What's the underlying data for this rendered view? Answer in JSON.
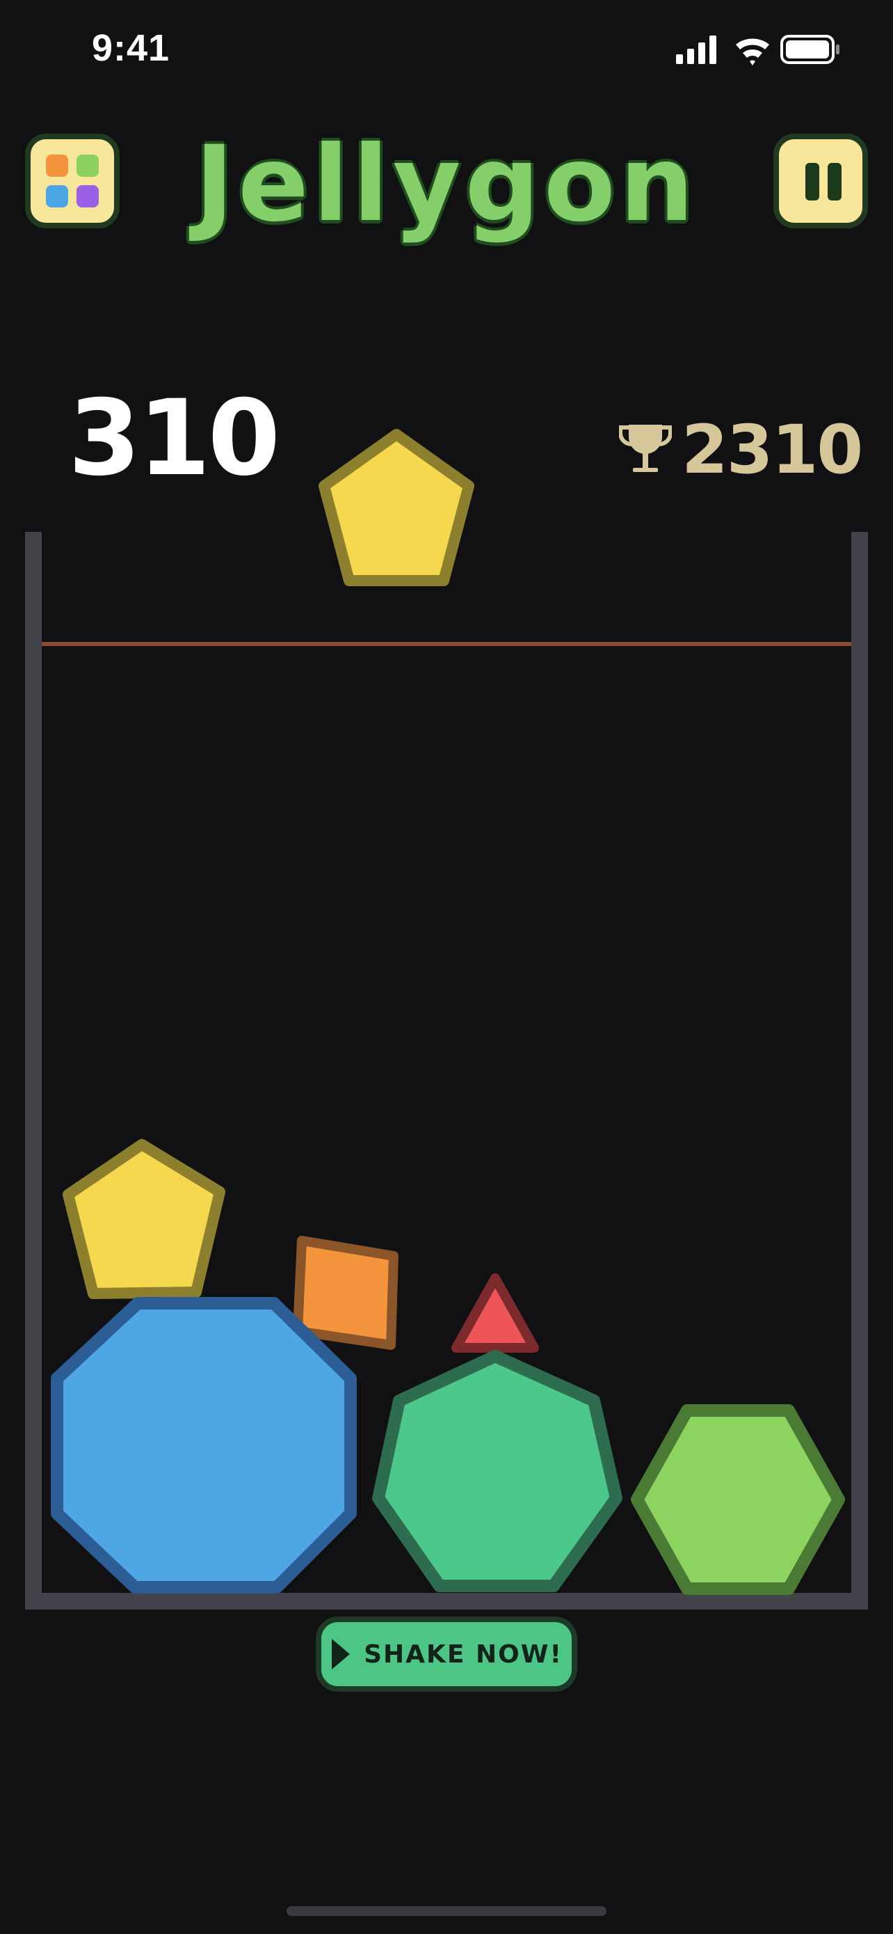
{
  "status_bar": {
    "time": "9:41"
  },
  "header": {
    "title": "Jellygon",
    "menu_icon": "grid-icon",
    "menu_dot_colors": [
      "#f4953e",
      "#8ad160",
      "#4ca6e4",
      "#9a61e6"
    ],
    "pause_icon": "pause-icon"
  },
  "scores": {
    "current": "310",
    "best": "2310",
    "best_icon": "trophy-icon"
  },
  "pieces": {
    "next": {
      "shape": "pentagon",
      "color": "#f6d84f",
      "outline": "#8c7f2e"
    },
    "in_container": [
      {
        "shape": "pentagon",
        "color": "#f6d84f",
        "outline": "#8c7f2e"
      },
      {
        "shape": "square",
        "color": "#f4953e",
        "outline": "#8a5528"
      },
      {
        "shape": "triangle",
        "color": "#ee5558",
        "outline": "#7c2a2c"
      },
      {
        "shape": "octagon",
        "color": "#4ea6e4",
        "outline": "#2c5d94"
      },
      {
        "shape": "heptagon",
        "color": "#4cc88a",
        "outline": "#2d6c4e"
      },
      {
        "shape": "hexagon",
        "color": "#8bd45f",
        "outline": "#4a7a34"
      }
    ]
  },
  "actions": {
    "shake_label": "SHAKE NOW!",
    "shake_icon": "play-icon"
  },
  "colors": {
    "background": "#111113",
    "wall": "#43444b",
    "danger_line": "#8a4a35",
    "title_fill": "#84cf6a",
    "button_fill": "#f8e69a"
  }
}
